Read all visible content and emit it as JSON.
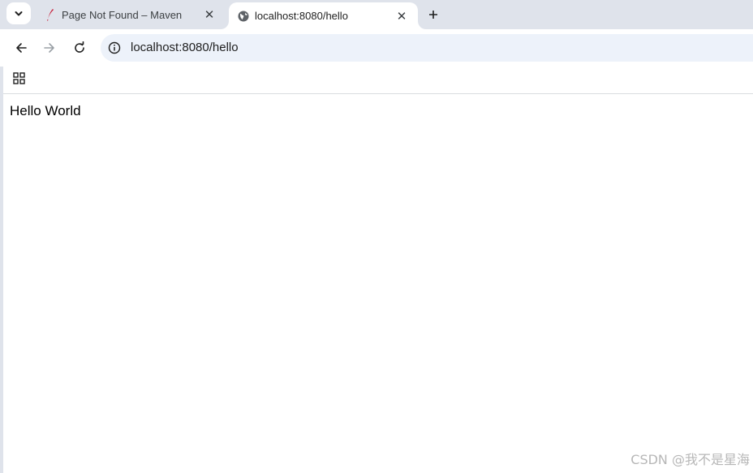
{
  "tabs": [
    {
      "title": "Page Not Found – Maven",
      "favicon": "maven-feather-icon",
      "active": false
    },
    {
      "title": "localhost:8080/hello",
      "favicon": "globe-icon",
      "active": true
    }
  ],
  "address_bar": {
    "url": "localhost:8080/hello"
  },
  "page": {
    "body_text": "Hello World"
  },
  "watermark": "CSDN @我不是星海",
  "colors": {
    "tab_strip": "#dfe3eb",
    "omnibox": "#edf2fa",
    "maven_feather": "#c71a36"
  }
}
